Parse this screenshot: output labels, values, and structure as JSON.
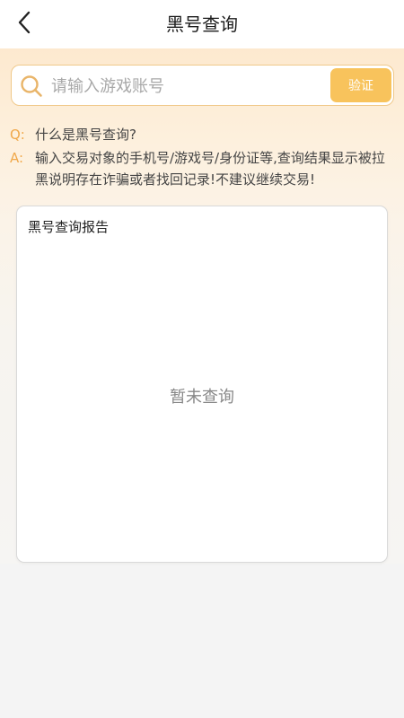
{
  "header": {
    "title": "黑号查询",
    "back_icon": "chevron-left-icon"
  },
  "search": {
    "placeholder": "请输入游戏账号",
    "value": "",
    "icon": "search-icon",
    "verify_label": "验证"
  },
  "faq": {
    "q_prefix": "Q:",
    "question": "什么是黑号查询?",
    "a_prefix": "A:",
    "answer": "输入交易对象的手机号/游戏号/身份证等,查询结果显示被拉黑说明存在诈骗或者找回记录!不建议继续交易!"
  },
  "report": {
    "title": "黑号查询报告",
    "empty_text": "暂未查询"
  },
  "colors": {
    "accent": "#f8c35c",
    "search_border": "#f0c98a",
    "faq_prefix": "#f0a84a"
  }
}
